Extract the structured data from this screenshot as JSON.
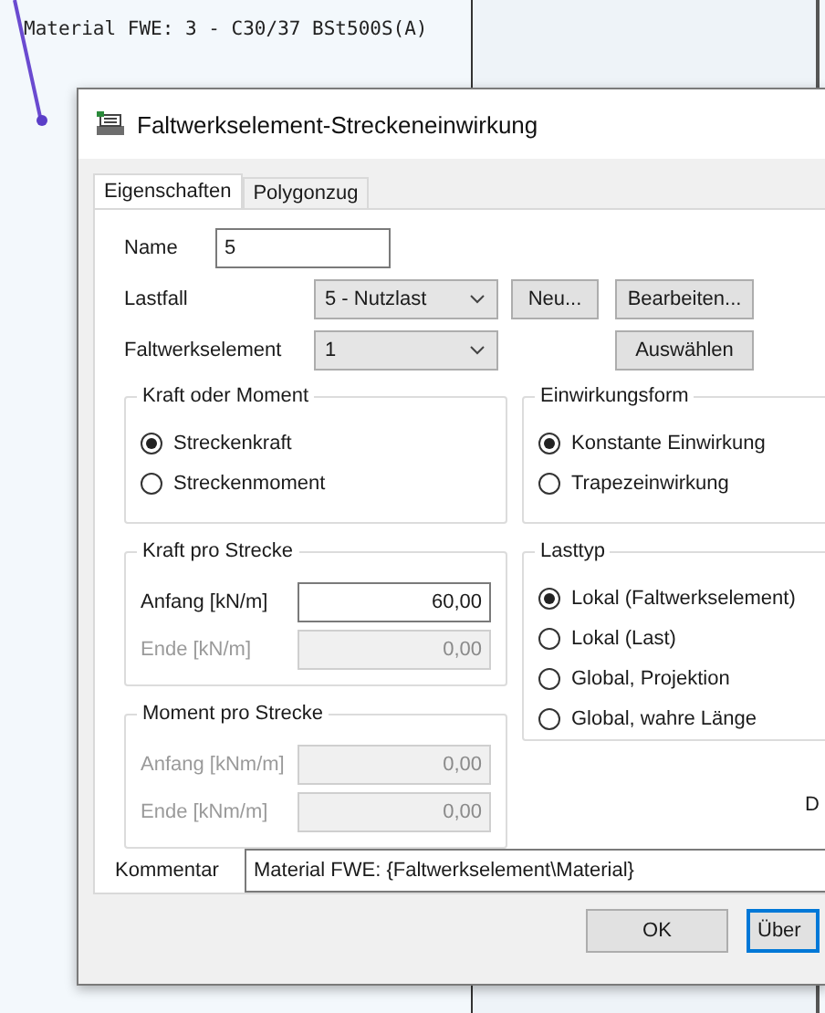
{
  "background": {
    "label": "Material FWE: 3 - C30/37 BSt500S(A)"
  },
  "dialog": {
    "title": "Faltwerkselement-Streckeneinwirkung",
    "tabs": [
      {
        "label": "Eigenschaften",
        "selected": true
      },
      {
        "label": "Polygonzug",
        "selected": false
      }
    ],
    "name": {
      "label": "Name",
      "value": "5"
    },
    "lastfall": {
      "label": "Lastfall",
      "value": "5 - Nutzlast"
    },
    "element": {
      "label": "Faltwerkselement",
      "value": "1"
    },
    "new_button": "Neu...",
    "edit_button": "Bearbeiten...",
    "select_button": "Auswählen",
    "kraft_oder_moment": {
      "title": "Kraft oder Moment",
      "options": [
        {
          "label": "Streckenkraft",
          "selected": true
        },
        {
          "label": "Streckenmoment",
          "selected": false
        }
      ]
    },
    "einwirkungsform": {
      "title": "Einwirkungsform",
      "options": [
        {
          "label": "Konstante Einwirkung",
          "selected": true
        },
        {
          "label": "Trapezeinwirkung",
          "selected": false
        }
      ]
    },
    "kraft_pro_strecke": {
      "title": "Kraft pro Strecke",
      "fields": [
        {
          "label": "Anfang [kN/m]",
          "value": "60,00",
          "disabled": false
        },
        {
          "label": "Ende [kN/m]",
          "value": "0,00",
          "disabled": true
        }
      ]
    },
    "lasttyp": {
      "title": "Lasttyp",
      "options": [
        {
          "label": "Lokal (Faltwerkselement)",
          "selected": true
        },
        {
          "label": "Lokal (Last)",
          "selected": false
        },
        {
          "label": "Global, Projektion",
          "selected": false
        },
        {
          "label": "Global, wahre Länge",
          "selected": false
        }
      ]
    },
    "moment_pro_strecke": {
      "title": "Moment pro Strecke",
      "fields": [
        {
          "label": "Anfang [kNm/m]",
          "value": "0,00",
          "disabled": true
        },
        {
          "label": "Ende [kNm/m]",
          "value": "0,00",
          "disabled": true
        }
      ]
    },
    "cut_label": "D",
    "kommentar": {
      "label": "Kommentar",
      "value": "Material FWE: {Faltwerkselement\\Material}"
    },
    "buttons": [
      {
        "label": "OK",
        "default": false
      },
      {
        "label": "Über",
        "default": true
      }
    ]
  }
}
